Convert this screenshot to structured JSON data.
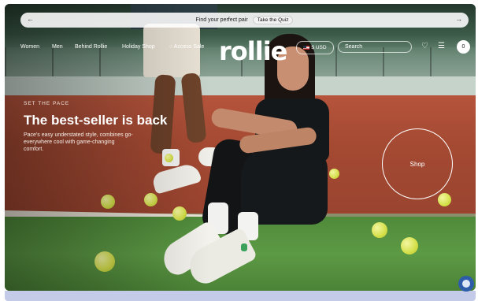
{
  "promo_bar": {
    "text": "Find your perfect pair",
    "button": "Take the Quiz",
    "prev_icon": "arrow-left-icon",
    "next_icon": "arrow-right-icon"
  },
  "nav": {
    "items": [
      "Women",
      "Men",
      "Behind Rollie",
      "Holiday Shop",
      "Access Sale"
    ],
    "logo": "rollie",
    "currency": "$ USD",
    "search_placeholder": "Search",
    "wishlist_icon": "heart-icon",
    "menu_icon": "hamburger-icon",
    "account_label": "0"
  },
  "hero": {
    "eyebrow": "SET THE PACE",
    "headline": "The best-seller is back",
    "subtext": "Pace's easy understated style, combines go-everywhere cool with game-changing comfort.",
    "cta": "Shop"
  },
  "colors": {
    "clay": "#a54a33",
    "grass": "#5d9a45",
    "ball": "#d5e04a",
    "chat": "#2d5da8"
  }
}
